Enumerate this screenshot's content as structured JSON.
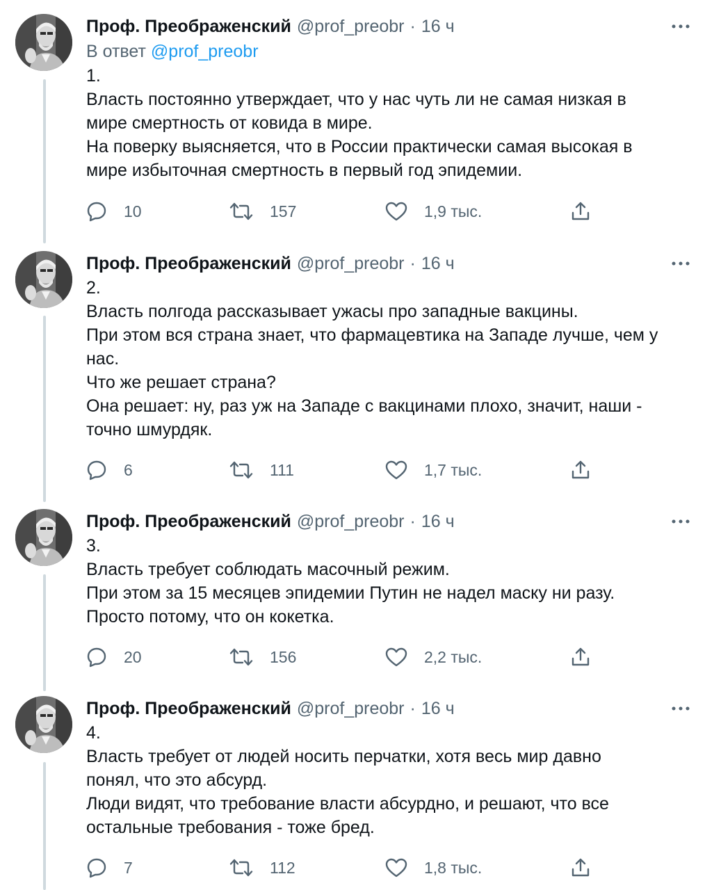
{
  "tweets": [
    {
      "author_name": "Проф. Преображенский",
      "handle": "@prof_preobr",
      "separator": "·",
      "time": "16 ч",
      "reply_prefix": "В ответ",
      "reply_mention": "@prof_preobr",
      "lines": [
        "1.",
        "Власть постоянно утверждает, что у нас чуть ли не самая низкая в мире смертность от ковида в мире.",
        "На поверку выясняется, что в России практически самая высокая в мире избыточная смертность в первый год эпидемии."
      ],
      "replies": "10",
      "retweets": "157",
      "likes": "1,9 тыс."
    },
    {
      "author_name": "Проф. Преображенский",
      "handle": "@prof_preobr",
      "separator": "·",
      "time": "16 ч",
      "lines": [
        "2.",
        "Власть полгода рассказывает ужасы про западные вакцины.",
        "При этом вся страна знает, что фармацевтика на Западе лучше, чем у нас.",
        "Что же решает страна?",
        "Она решает: ну, раз уж на Западе с вакцинами плохо, значит, наши - точно шмурдяк."
      ],
      "replies": "6",
      "retweets": "111",
      "likes": "1,7 тыс."
    },
    {
      "author_name": "Проф. Преображенский",
      "handle": "@prof_preobr",
      "separator": "·",
      "time": "16 ч",
      "lines": [
        "3.",
        "Власть требует соблюдать масочный режим.",
        "При этом за 15 месяцев эпидемии Путин не надел маску ни разу.",
        "Просто потому, что он кокетка."
      ],
      "replies": "20",
      "retweets": "156",
      "likes": "2,2 тыс."
    },
    {
      "author_name": "Проф. Преображенский",
      "handle": "@prof_preobr",
      "separator": "·",
      "time": "16 ч",
      "lines": [
        "4.",
        "Власть требует от людей носить перчатки, хотя весь мир давно понял, что это абсурд.",
        "Люди видят, что требование власти абсурдно, и решают, что все остальные требования - тоже бред."
      ],
      "replies": "7",
      "retweets": "112",
      "likes": "1,8 тыс."
    }
  ],
  "colors": {
    "text": "#0f1419",
    "secondary": "#536471",
    "link": "#1d9bf0",
    "thread_line": "#cfd9de"
  },
  "icons": [
    "avatar-photo",
    "more-icon",
    "reply-icon",
    "retweet-icon",
    "like-icon",
    "share-icon"
  ]
}
